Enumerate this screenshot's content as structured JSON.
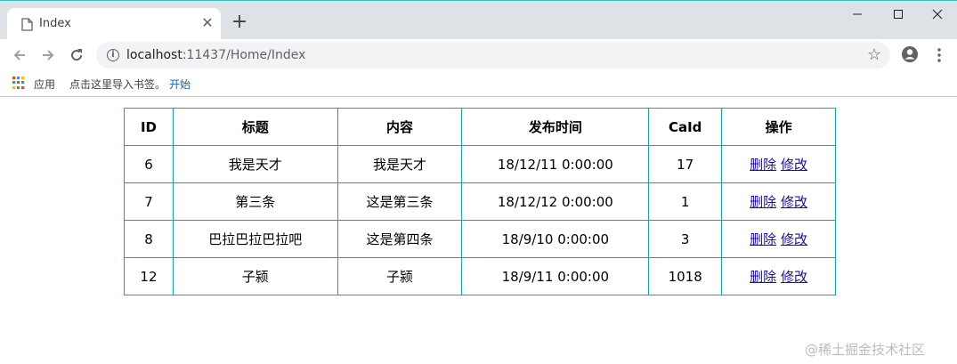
{
  "browser": {
    "tab_title": "Index",
    "tab_close_glyph": "✕",
    "new_tab_glyph": "+",
    "url_host": "localhost",
    "url_rest": ":11437/Home/Index",
    "bookmarks": {
      "apps_label": "应用",
      "import_label": "点击这里导入书签。",
      "start_label": "开始"
    },
    "icons": {
      "info": "info-icon",
      "star": "star-icon",
      "profile": "profile-icon",
      "menu": "menu-icon"
    }
  },
  "table": {
    "headers": [
      "ID",
      "标题",
      "内容",
      "发布时间",
      "CaId",
      "操作"
    ],
    "rows": [
      {
        "id": "6",
        "title": "我是天才",
        "content": "我是天才",
        "time": "18/12/11 0:00:00",
        "caid": "17"
      },
      {
        "id": "7",
        "title": "第三条",
        "content": "这是第三条",
        "time": "18/12/12 0:00:00",
        "caid": "1"
      },
      {
        "id": "8",
        "title": "巴拉巴拉巴拉吧",
        "content": "这是第四条",
        "time": "18/9/10 0:00:00",
        "caid": "3"
      },
      {
        "id": "12",
        "title": "子颍",
        "content": "子颍",
        "time": "18/9/11 0:00:00",
        "caid": "1018"
      }
    ],
    "actions": {
      "delete": "删除",
      "edit": "修改"
    },
    "border_color": "#17a2b8"
  },
  "watermark": "@稀土掘金技术社区",
  "colors": {
    "tab_strip": "#dee1e6",
    "accent_line": "#35b8c0",
    "link": "#1a0dab"
  }
}
